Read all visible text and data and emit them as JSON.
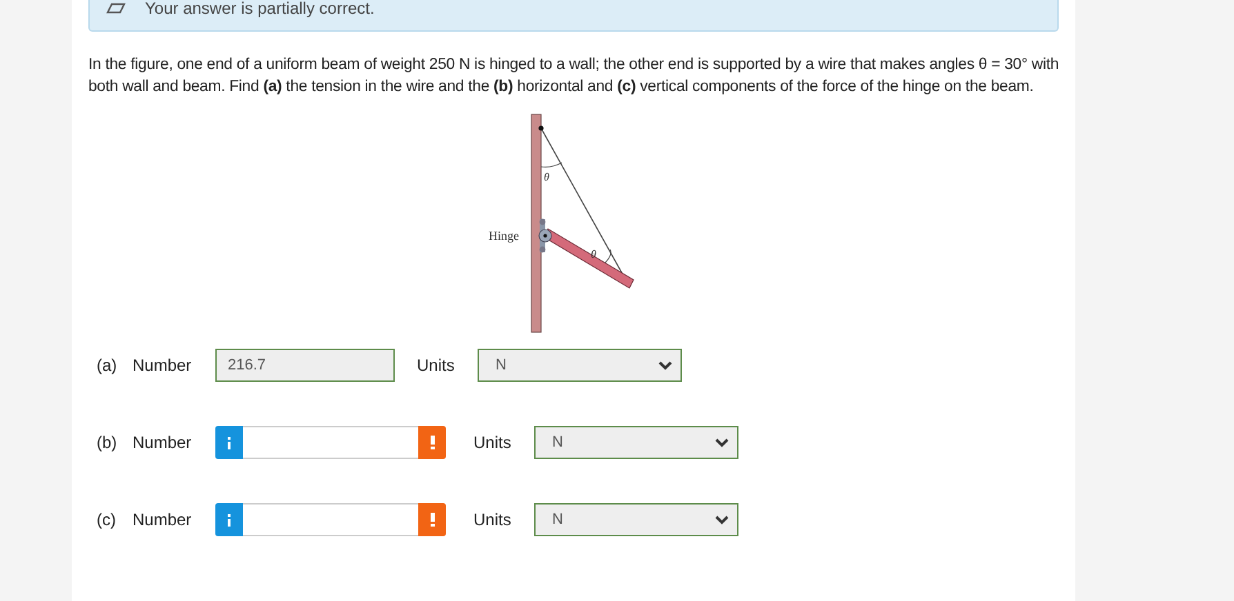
{
  "banner": {
    "text": "Your answer is partially correct."
  },
  "question": "In the figure, one end of a uniform beam of weight 250 N is hinged to a wall; the other end is supported by a wire that makes angles θ = 30° with both wall and beam. Find **(a)** the tension in the wire and the **(b)** horizontal and **(c)** vertical components of the force of the hinge on the beam.",
  "figure": {
    "hinge_label": "Hinge",
    "angle_labels": [
      "θ",
      "θ"
    ]
  },
  "answers": [
    {
      "part": "(a)",
      "label": "Number",
      "kind": "answered",
      "value": "216.7",
      "units_label": "Units",
      "unit": "N"
    },
    {
      "part": "(b)",
      "label": "Number",
      "kind": "empty",
      "units_label": "Units",
      "unit": "N"
    },
    {
      "part": "(c)",
      "label": "Number",
      "kind": "empty",
      "units_label": "Units",
      "unit": "N"
    }
  ]
}
